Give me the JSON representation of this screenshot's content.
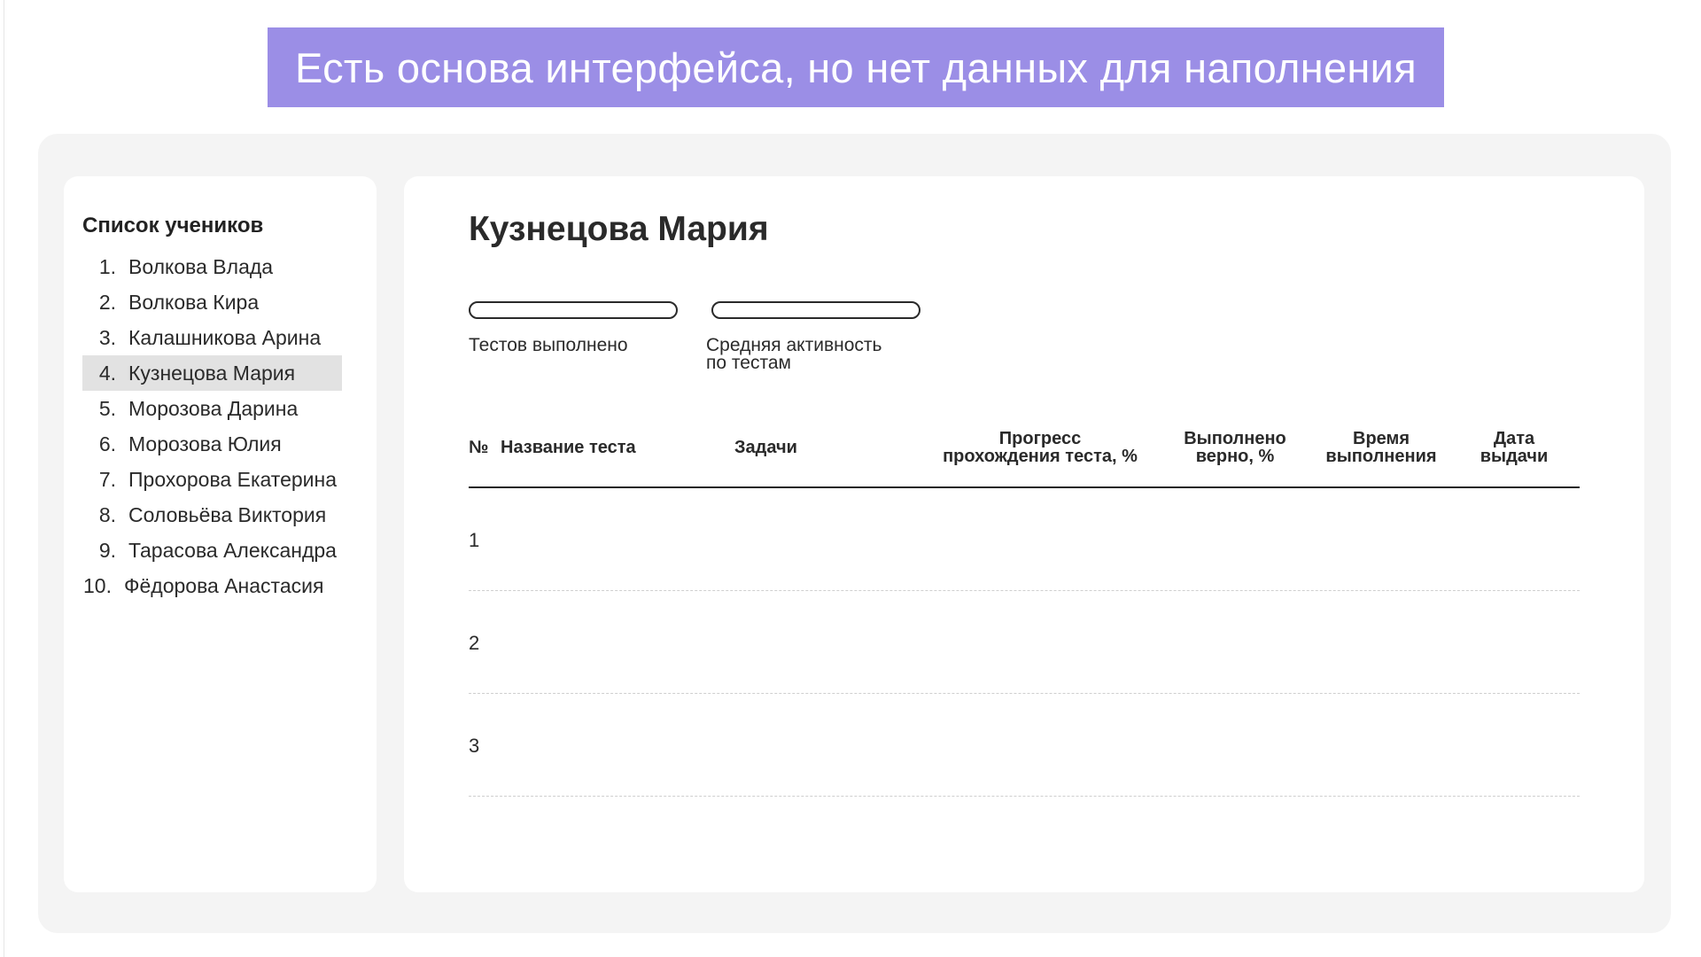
{
  "banner": {
    "text": "Есть основа интерфейса, но нет данных для наполнения"
  },
  "sidebar": {
    "title": "Список учеников",
    "students": [
      {
        "num": "1.",
        "name": "Волкова Влада"
      },
      {
        "num": "2.",
        "name": "Волкова Кира"
      },
      {
        "num": "3.",
        "name": "Калашникова Арина"
      },
      {
        "num": "4.",
        "name": "Кузнецова Мария"
      },
      {
        "num": "5.",
        "name": "Морозова Дарина"
      },
      {
        "num": "6.",
        "name": "Морозова Юлия"
      },
      {
        "num": "7.",
        "name": "Прохорова Екатерина"
      },
      {
        "num": "8.",
        "name": "Соловьёва Виктория"
      },
      {
        "num": "9.",
        "name": "Тарасова Александра"
      },
      {
        "num": "10.",
        "name": "Фёдорова Анастасия"
      }
    ],
    "selected_index": 3
  },
  "main": {
    "student_name": "Кузнецова Мария",
    "stats": [
      {
        "label_line1": "Тестов выполнено",
        "label_line2": "",
        "progress": 0
      },
      {
        "label_line1": "Средняя активность",
        "label_line2": "по тестам",
        "progress": 0
      }
    ],
    "table": {
      "headers": {
        "num": "№",
        "test_name": "Название теста",
        "tasks": "Задачи",
        "progress_line1": "Прогресс",
        "progress_line2": "прохождения теста, %",
        "correct_line1": "Выполнено",
        "correct_line2": "верно, %",
        "time_line1": "Время",
        "time_line2": "выполнения",
        "date_line1": "Дата",
        "date_line2": "выдачи"
      },
      "rows": [
        {
          "num": "1"
        },
        {
          "num": "2"
        },
        {
          "num": "3"
        }
      ]
    }
  },
  "colors": {
    "accent": "#9b8ee6",
    "stage_bg": "#f4f4f4",
    "selected_bg": "#e2e2e2"
  }
}
